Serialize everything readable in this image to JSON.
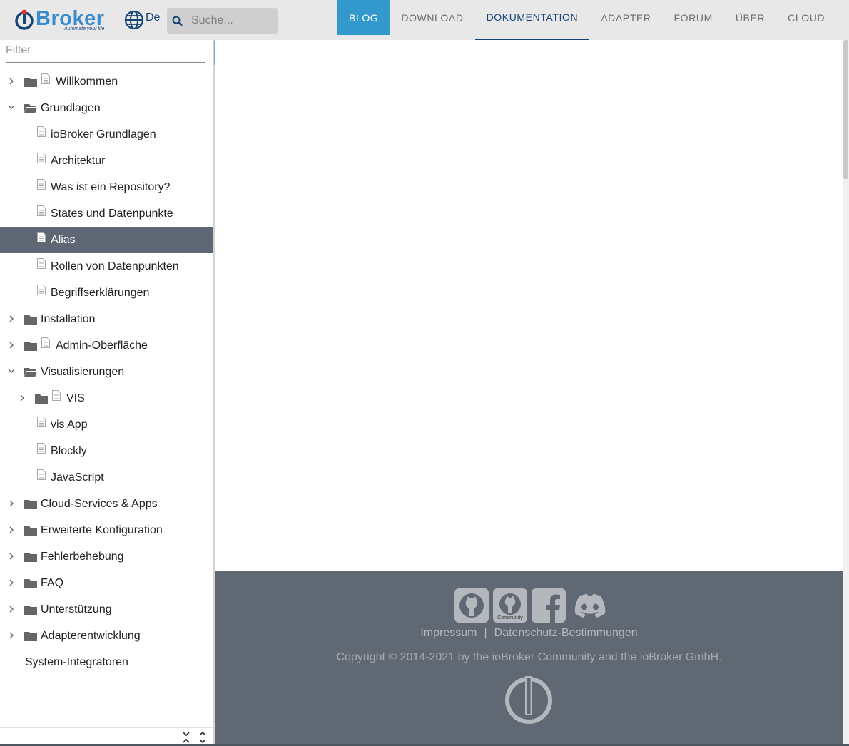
{
  "header": {
    "logo_text": "Broker",
    "logo_tagline": "Automate your life",
    "language": "De",
    "search_placeholder": "Suche...",
    "nav": [
      {
        "label": "BLOG"
      },
      {
        "label": "DOWNLOAD"
      },
      {
        "label": "DOKUMENTATION"
      },
      {
        "label": "ADAPTER"
      },
      {
        "label": "FORUM"
      },
      {
        "label": "ÜBER"
      },
      {
        "label": "CLOUD"
      }
    ]
  },
  "sidebar": {
    "filter_placeholder": "Filter",
    "items": [
      {
        "label": "Willkommen"
      },
      {
        "label": "Grundlagen"
      },
      {
        "label": "ioBroker Grundlagen"
      },
      {
        "label": "Architektur"
      },
      {
        "label": "Was ist ein Repository?"
      },
      {
        "label": "States und Datenpunkte"
      },
      {
        "label": "Alias"
      },
      {
        "label": "Rollen von Datenpunkten"
      },
      {
        "label": "Begriffserklärungen"
      },
      {
        "label": "Installation"
      },
      {
        "label": "Admin-Oberfläche"
      },
      {
        "label": "Visualisierungen"
      },
      {
        "label": "VIS"
      },
      {
        "label": "vis App"
      },
      {
        "label": "Blockly"
      },
      {
        "label": "JavaScript"
      },
      {
        "label": "Cloud-Services & Apps"
      },
      {
        "label": "Erweiterte Konfiguration"
      },
      {
        "label": "Fehlerbehebung"
      },
      {
        "label": "FAQ"
      },
      {
        "label": "Unterstützung"
      },
      {
        "label": "Adapterentwicklung"
      },
      {
        "label": "System-Integratoren"
      }
    ]
  },
  "footer": {
    "community_badge": "Community",
    "impressum": "Impressum",
    "separator": "|",
    "datenschutz": "Datenschutz-Bestimmungen",
    "copyright": "Copyright © 2014-2021 by the ioBroker Community and the ioBroker GmbH."
  },
  "colors": {
    "brand_blue": "#3399cc",
    "nav_active": "#164477",
    "selected_row": "#5f6774",
    "footer_bg": "#5f6873"
  }
}
